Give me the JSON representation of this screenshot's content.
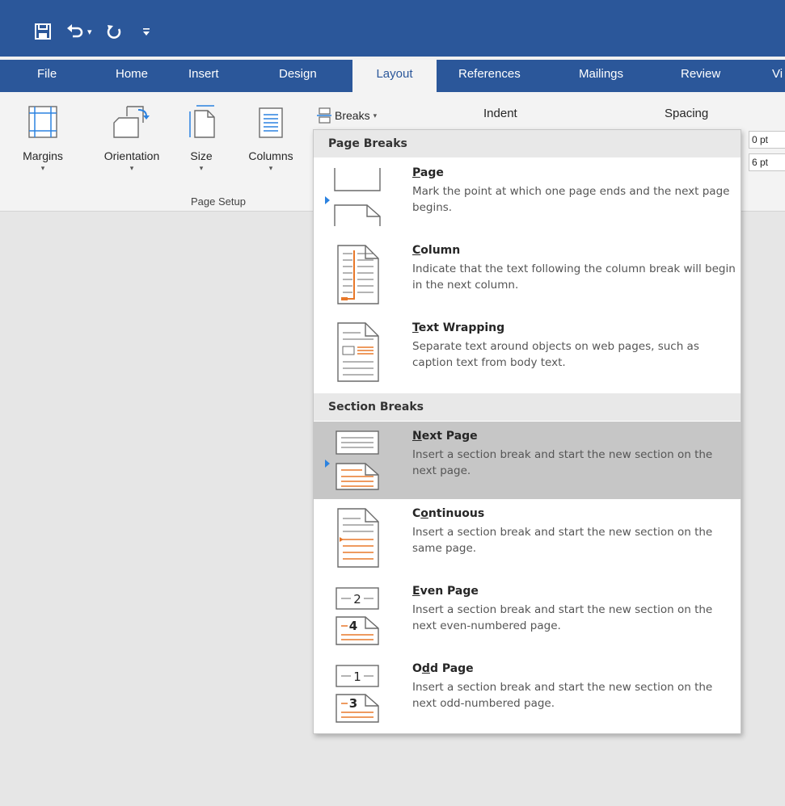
{
  "qat": {
    "save_icon": "save-icon",
    "undo_icon": "undo-icon",
    "undo_dropdown": "▾",
    "redo_icon": "redo-icon",
    "customize_icon": "customize-qat-icon"
  },
  "tabs": {
    "file": "File",
    "home": "Home",
    "insert": "Insert",
    "design": "Design",
    "layout": "Layout",
    "references": "References",
    "mailings": "Mailings",
    "review": "Review",
    "view": "Vi"
  },
  "ribbon": {
    "margins": "Margins",
    "orientation": "Orientation",
    "size": "Size",
    "columns": "Columns",
    "breaks": "Breaks",
    "group_label": "Page Setup",
    "indent": "Indent",
    "spacing": "Spacing",
    "spacing_before": "0 pt",
    "spacing_after": "6 pt",
    "colon": ":"
  },
  "menu": {
    "page_breaks_header": "Page Breaks",
    "section_breaks_header": "Section Breaks",
    "items": [
      {
        "key": "P",
        "rest": "age",
        "desc": "Mark the point at which one page ends and the next page begins.",
        "icon": "page-break-icon"
      },
      {
        "key": "C",
        "rest": "olumn",
        "desc": "Indicate that the text following the column break will begin in the next column.",
        "icon": "column-break-icon"
      },
      {
        "key": "T",
        "rest": "ext Wrapping",
        "desc": "Separate text around objects on web pages, such as caption text from body text.",
        "icon": "text-wrapping-break-icon"
      },
      {
        "key": "N",
        "rest": "ext Page",
        "desc": "Insert a section break and start the new section on the next page.",
        "icon": "next-page-break-icon"
      },
      {
        "pre": "C",
        "key": "o",
        "rest": "ntinuous",
        "desc": "Insert a section break and start the new section on the same page.",
        "icon": "continuous-break-icon"
      },
      {
        "key": "E",
        "rest": "ven Page",
        "desc": "Insert a section break and start the new section on the next even-numbered page.",
        "icon": "even-page-break-icon",
        "nums": [
          "2",
          "4"
        ]
      },
      {
        "pre": "O",
        "key": "d",
        "rest": "d Page",
        "desc": "Insert a section break and start the new section on the next odd-numbered page.",
        "icon": "odd-page-break-icon",
        "nums": [
          "1",
          "3"
        ]
      }
    ]
  },
  "colors": {
    "title_blue": "#2b579a",
    "accent_orange": "#e8782a",
    "pointer_blue": "#2b82e0",
    "highlight_gray": "#c6c6c6"
  }
}
